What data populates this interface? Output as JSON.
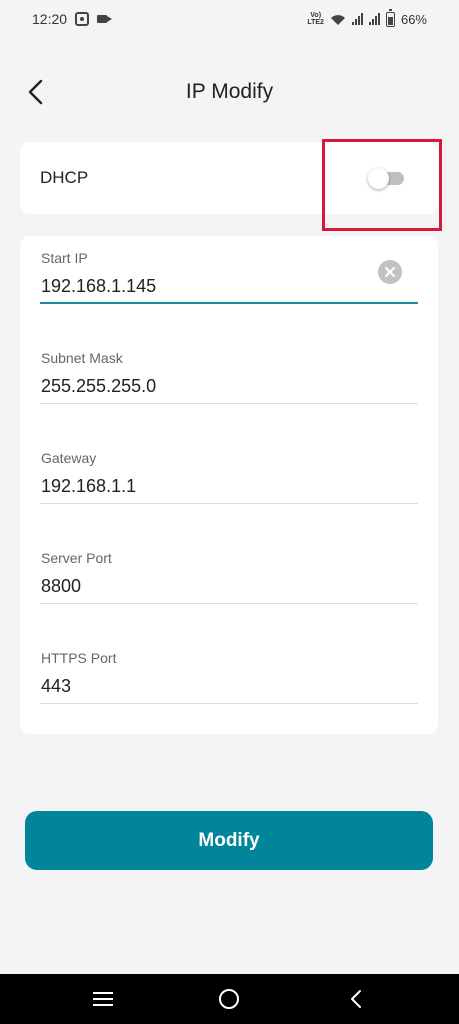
{
  "status_bar": {
    "time": "12:20",
    "volte_top": "Vo)",
    "volte_bottom": "LTE2",
    "battery": "66%"
  },
  "header": {
    "back_icon": "chevron-left-icon",
    "title": "IP Modify"
  },
  "dhcp": {
    "label": "DHCP",
    "enabled": false
  },
  "fields": [
    {
      "label": "Start IP",
      "value": "192.168.1.145",
      "focused": true
    },
    {
      "label": "Subnet Mask",
      "value": "255.255.255.0"
    },
    {
      "label": "Gateway",
      "value": "192.168.1.1"
    },
    {
      "label": "Server Port",
      "value": "8800"
    },
    {
      "label": "HTTPS Port",
      "value": "443"
    }
  ],
  "modify_button": {
    "label": "Modify"
  },
  "nav_bar": {
    "icons": [
      "menu-icon",
      "home-circle-icon",
      "back-icon"
    ]
  },
  "colors": {
    "accent": "#00859a",
    "focus_line": "#1f8a9e",
    "highlight": "#d6183a",
    "background": "#f4f4f6"
  }
}
